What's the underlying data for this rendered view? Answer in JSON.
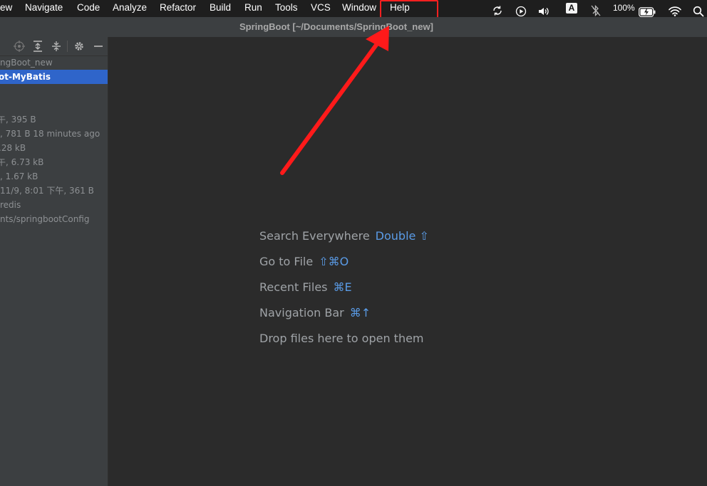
{
  "menubar": {
    "items": [
      "ew",
      "Navigate",
      "Code",
      "Analyze",
      "Refactor",
      "Build",
      "Run",
      "Tools",
      "VCS",
      "Window",
      "Help"
    ],
    "battery": "100%",
    "input_source": "A"
  },
  "window": {
    "title": "SpringBoot [~/Documents/SpringBoot_new]"
  },
  "project_panel": {
    "tree": [
      {
        "text": "ngBoot_new"
      },
      {
        "text": "ot-MyBatis",
        "selected": true
      },
      {
        "text": "午, 395 B"
      },
      {
        "text": ", 781 B 18 minutes ago"
      },
      {
        "text": ".28 kB"
      },
      {
        "text": "午, 6.73 kB"
      },
      {
        "text": ", 1.67 kB"
      },
      {
        "text": "11/9, 8:01 下午, 361 B"
      },
      {
        "text": "redis"
      },
      {
        "text": "nts/springbootConfig"
      }
    ]
  },
  "editor": {
    "hints": [
      {
        "label": "Search Everywhere",
        "shortcut": "Double ⇧"
      },
      {
        "label": "Go to File",
        "shortcut": "⇧⌘O"
      },
      {
        "label": "Recent Files",
        "shortcut": "⌘E"
      },
      {
        "label": "Navigation Bar",
        "shortcut": "⌘↑"
      },
      {
        "label": "Drop files here to open them",
        "shortcut": ""
      }
    ]
  },
  "colors": {
    "highlight": "#ff2020",
    "selection": "#2f65ca",
    "shortcut": "#5a9be6"
  }
}
